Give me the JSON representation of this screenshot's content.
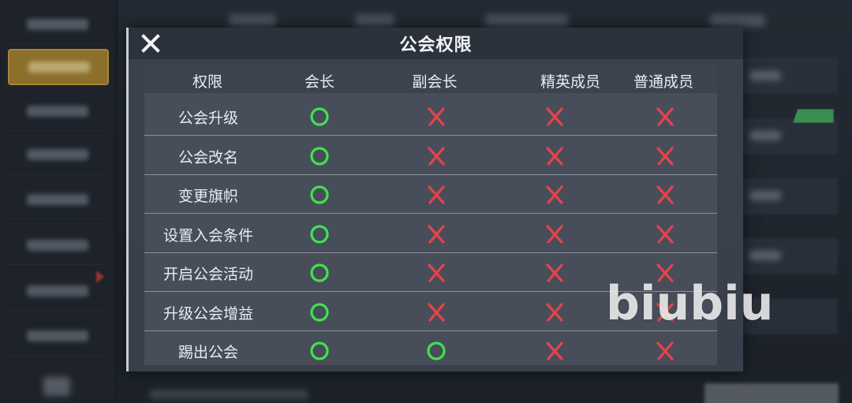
{
  "dialog": {
    "title": "公会权限",
    "close_icon": "close-x-icon"
  },
  "table": {
    "columns": [
      "权限",
      "会长",
      "副会长",
      "精英成员",
      "普通成员"
    ],
    "rows": [
      {
        "label": "公会升级",
        "perms": [
          true,
          false,
          false,
          false
        ]
      },
      {
        "label": "公会改名",
        "perms": [
          true,
          false,
          false,
          false
        ]
      },
      {
        "label": "变更旗帜",
        "perms": [
          true,
          false,
          false,
          false
        ]
      },
      {
        "label": "设置入会条件",
        "perms": [
          true,
          false,
          false,
          false
        ]
      },
      {
        "label": "开启公会活动",
        "perms": [
          true,
          false,
          false,
          false
        ]
      },
      {
        "label": "升级公会增益",
        "perms": [
          true,
          false,
          false,
          false
        ]
      },
      {
        "label": "踢出公会",
        "perms": [
          true,
          true,
          false,
          false
        ]
      }
    ],
    "allowed_icon": "green-circle-icon",
    "denied_icon": "red-cross-icon"
  },
  "watermark": "biubiu",
  "colors": {
    "allowed": "#3ee44a",
    "denied": "#e8424a",
    "active_tab": "#b2892d",
    "header_bg": "#2c323c"
  }
}
